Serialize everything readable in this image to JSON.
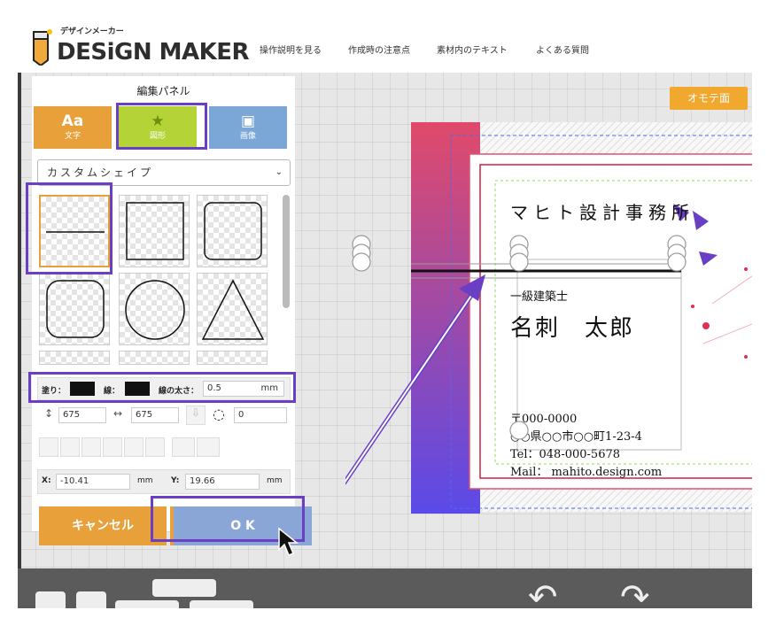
{
  "header": {
    "logo_kana": "デザインメーカー",
    "logo_text": "DESiGN MAKER",
    "nav": [
      "操作説明を見る",
      "作成時の注意点",
      "素材内のテキスト",
      "よくある質問"
    ]
  },
  "panel": {
    "title": "編集パネル",
    "tabs": [
      {
        "big": "Aa",
        "label": "文字",
        "color": "#e8a03a"
      },
      {
        "big": "★",
        "label": "図形",
        "color": "#b3d336"
      },
      {
        "big": "▣",
        "label": "画像",
        "color": "#7ba7d6"
      }
    ],
    "dropdown_value": "カスタムシェイプ",
    "props": {
      "fill_label": "塗り：",
      "stroke_label": "線：",
      "stroke_width_label": "線の太さ：",
      "stroke_width_value": "0.5",
      "stroke_width_unit": "mm",
      "height_value": "675",
      "width_value": "675",
      "rotation_value": "0",
      "x_label": "X:",
      "x_value": "-10.41",
      "x_unit": "mm",
      "y_label": "Y:",
      "y_value": "19.66",
      "y_unit": "mm"
    },
    "cancel_label": "キャンセル",
    "ok_label": "O K"
  },
  "canvas": {
    "side_badge": "オモテ面",
    "card": {
      "company": "マヒト設計事務所",
      "title": "一級建築士",
      "name": "名刺　太郎",
      "postal": "〒000-0000",
      "address": "○○県○○市○○町1-23-4",
      "tel": "Tel：048-000-5678",
      "mail": "Mail： mahito.design.com"
    }
  },
  "colors": {
    "highlight": "#6a3fc4",
    "accent_orange": "#e8a03a",
    "ok_blue": "#8aa6d6"
  }
}
